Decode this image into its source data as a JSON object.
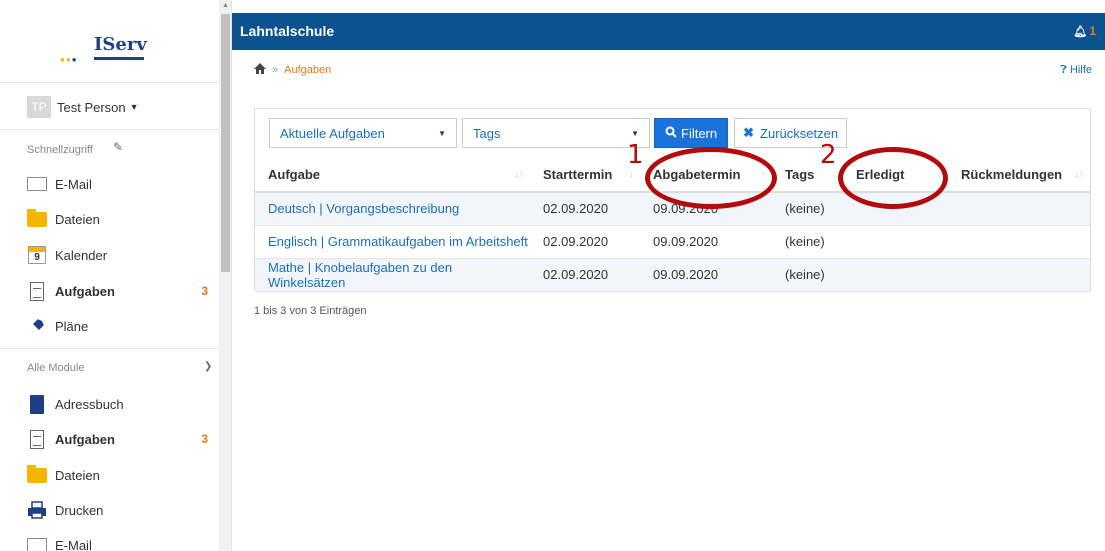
{
  "brand": {
    "logo_text": "IServ"
  },
  "user": {
    "initials": "TP",
    "name": "Test Person"
  },
  "sidebar": {
    "quick_label": "Schnellzugriff",
    "quick_items": [
      {
        "label": "E-Mail",
        "icon": "mail-icon"
      },
      {
        "label": "Dateien",
        "icon": "folder-icon"
      },
      {
        "label": "Kalender",
        "icon": "calendar-icon",
        "day": "9"
      },
      {
        "label": "Aufgaben",
        "icon": "clipboard-icon",
        "badge": "3"
      },
      {
        "label": "Pläne",
        "icon": "pin-icon"
      }
    ],
    "all_label": "Alle Module",
    "all_items": [
      {
        "label": "Adressbuch",
        "icon": "book-icon"
      },
      {
        "label": "Aufgaben",
        "icon": "clipboard-icon",
        "badge": "3"
      },
      {
        "label": "Dateien",
        "icon": "folder-icon"
      },
      {
        "label": "Drucken",
        "icon": "printer-icon"
      },
      {
        "label": "E-Mail",
        "icon": "mail-icon"
      }
    ]
  },
  "header": {
    "title": "Lahntalschule",
    "notification_count": "1"
  },
  "breadcrumb": {
    "current": "Aufgaben",
    "separator": "»"
  },
  "help": {
    "label": "Hilfe"
  },
  "filters": {
    "status_select": "Aktuelle Aufgaben",
    "tags_select": "Tags",
    "filter_button": "Filtern",
    "reset_button": "Zurücksetzen"
  },
  "table": {
    "columns": [
      "Aufgabe",
      "Starttermin",
      "Abgabetermin",
      "Tags",
      "Erledigt",
      "Rückmeldungen"
    ],
    "rows": [
      [
        "Deutsch | Vorgangsbeschreibung",
        "02.09.2020",
        "09.09.2020",
        "(keine)",
        "",
        ""
      ],
      [
        "Englisch | Grammatikaufgaben im Arbeitsheft",
        "02.09.2020",
        "09.09.2020",
        "(keine)",
        "",
        ""
      ],
      [
        "Mathe | Knobelaufgaben zu den Winkelsätzen",
        "02.09.2020",
        "09.09.2020",
        "(keine)",
        "",
        ""
      ]
    ],
    "info": "1 bis 3 von 3 Einträgen"
  },
  "annotations": {
    "one": "1",
    "two": "2"
  },
  "colors": {
    "header_blue": "#0d5290",
    "accent_orange": "#e07a1a",
    "link_blue": "#1a6fb8",
    "annotation_red": "#b30b0b"
  }
}
